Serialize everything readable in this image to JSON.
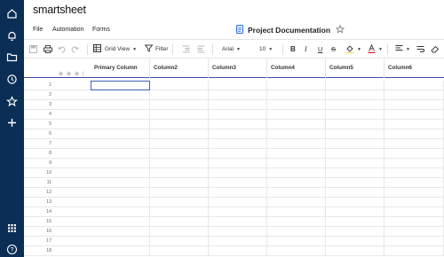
{
  "app": {
    "brand": "smartsheet"
  },
  "sidebar": {
    "icons": [
      "home-icon",
      "bell-icon",
      "folder-icon",
      "clock-icon",
      "star-icon",
      "plus-icon",
      "apps-grid-icon",
      "help-icon"
    ]
  },
  "menu": {
    "items": [
      "File",
      "Automation",
      "Forms"
    ]
  },
  "sheet": {
    "title": "Project Documentation"
  },
  "toolbar": {
    "view_label": "Grid View",
    "filter_label": "Filter",
    "font": "Arial",
    "font_size": "10"
  },
  "grid": {
    "columns": [
      "Primary Column",
      "Column2",
      "Column3",
      "Column4",
      "Column5",
      "Column6"
    ],
    "row_numbers": [
      "1",
      "2",
      "3",
      "4",
      "5",
      "6",
      "7",
      "8",
      "9",
      "10",
      "11",
      "12",
      "13",
      "14",
      "15",
      "16",
      "17",
      "18"
    ]
  },
  "colors": {
    "rail": "#0b2e56",
    "accent": "#3e4ea6",
    "font_color_bar": "#e02020"
  }
}
